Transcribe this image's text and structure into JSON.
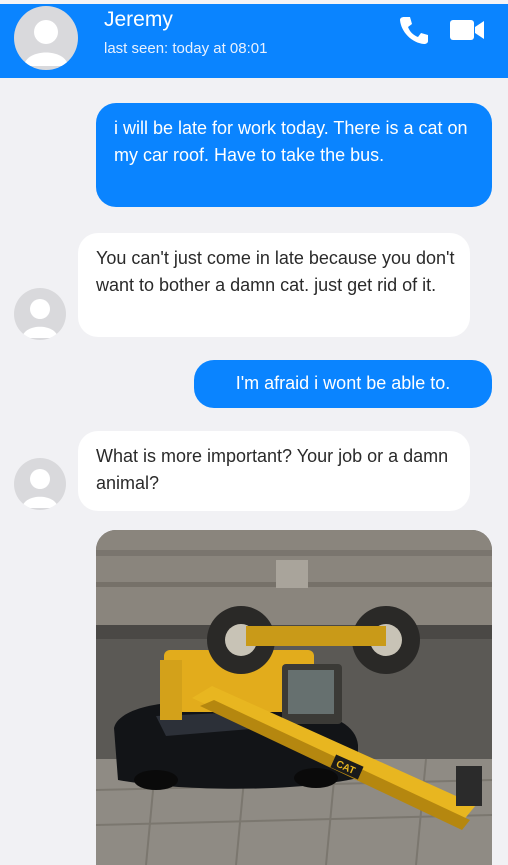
{
  "header": {
    "contact_name": "Jeremy",
    "last_seen": "last seen: today at 08:01",
    "icons": {
      "avatar": "person-silhouette-icon",
      "call": "phone-icon",
      "video": "video-camera-icon"
    },
    "accent_color": "#0a84ff"
  },
  "messages": [
    {
      "from": "me",
      "text": "i will be late for work today. There is a cat on my car roof. Have to take the bus."
    },
    {
      "from": "Jeremy",
      "text": "You can't just come in late because you don't want to bother a damn cat. just get rid of it."
    },
    {
      "from": "me",
      "text": "I'm afraid i wont be able to."
    },
    {
      "from": "Jeremy",
      "text": "What is more important? Your job or a damn animal?"
    }
  ],
  "photo": {
    "caption_text": "CAT",
    "subject": "overturned yellow CAT telehandler lying on a black car"
  },
  "colors": {
    "outgoing_bubble": "#0a84ff",
    "incoming_bubble": "#ffffff",
    "chat_background": "#f1f1f4",
    "machine_yellow": "#e8b620"
  }
}
